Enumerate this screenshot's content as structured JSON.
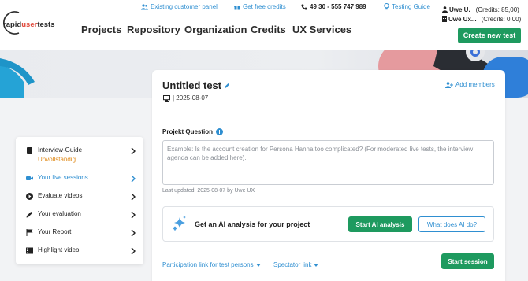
{
  "brand": {
    "logo_text_a": "rapid",
    "logo_text_b": "user",
    "logo_text_c": "tests"
  },
  "utility": {
    "existing_customer": "Existing customer panel",
    "free_credits": "Get free credits",
    "phone": "49 30 - 555 747 989",
    "testing_guide": "Testing Guide"
  },
  "nav": {
    "projects": "Projects",
    "repository": "Repository",
    "organization": "Organization",
    "credits": "Credits",
    "ux_services": "UX Services"
  },
  "user": {
    "row1_name": "Uwe U.",
    "row1_credits": "(Credits: 85,00)",
    "row2_name": "Uwe Ux...",
    "row2_credits": "(Credits: 0,00)",
    "create_test": "Create new test"
  },
  "test": {
    "title": "Untitled test",
    "date": "| 2025-08-07",
    "add_members": "Add members",
    "question_label": "Projekt Question",
    "question_placeholder": "Example: Is the account creation for Persona Hanna too complicated? (For moderated live tests, the interview agenda can be added here).",
    "last_updated": "Last updated: 2025-08-07 by Uwe UX",
    "ai_text": "Get an AI analysis for your project",
    "start_ai": "Start AI analysis",
    "what_ai": "What does AI do?",
    "participation_link": "Participation link for test persons",
    "spectator_link": "Spectator link",
    "start_session": "Start session"
  },
  "sidebar": {
    "items": [
      {
        "label": "Interview-Guide",
        "sub": "Unvollständig",
        "icon": "document-icon"
      },
      {
        "label": "Your live sessions",
        "icon": "video-camera-icon",
        "active": true
      },
      {
        "label": "Evaluate videos",
        "icon": "play-circle-icon"
      },
      {
        "label": "Your evaluation",
        "icon": "pencil-icon"
      },
      {
        "label": "Your Report",
        "icon": "flag-icon"
      },
      {
        "label": "Highlight video",
        "icon": "film-icon"
      }
    ]
  },
  "colors": {
    "accent_blue": "#2f8fd1",
    "brand_green": "#1e9a5f",
    "warning_orange": "#e08a18"
  }
}
